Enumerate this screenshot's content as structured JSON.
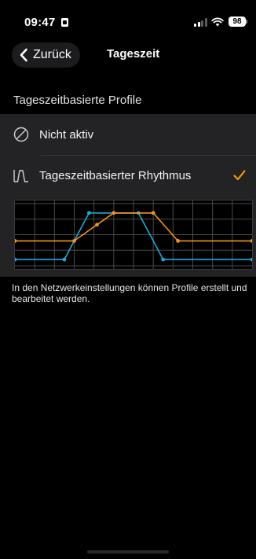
{
  "status_bar": {
    "time": "09:47",
    "battery": "98"
  },
  "header": {
    "back_label": "Zurück",
    "title": "Tageszeit"
  },
  "section": {
    "title": "Tageszeitbasierte Profile",
    "options": [
      {
        "label": "Nicht aktiv",
        "icon": "disabled-circle-icon",
        "selected": false
      },
      {
        "label": "Tageszeitbasierter Rhythmus",
        "icon": "rhythm-curve-icon",
        "selected": true
      }
    ]
  },
  "colors": {
    "accent": "#ff9f0a",
    "series_blue": "#1fa9d6",
    "series_orange": "#f0951e",
    "group_bg": "#232325"
  },
  "chart_data": {
    "type": "line",
    "x": [
      0,
      2,
      4,
      6,
      8,
      10,
      12,
      14,
      16,
      18,
      20,
      22,
      24
    ],
    "ylim": [
      0,
      100
    ],
    "grid": true,
    "series": [
      {
        "color": "#1fa9d6",
        "x": [
          0,
          5,
          7.5,
          12.5,
          15,
          24
        ],
        "values": [
          10,
          10,
          85,
          85,
          10,
          10
        ]
      },
      {
        "color": "#f0951e",
        "x": [
          0,
          6,
          8.3,
          10,
          14,
          16.5,
          24
        ],
        "values": [
          40,
          40,
          66,
          85,
          85,
          40,
          40
        ]
      }
    ]
  },
  "footer": {
    "text": "In den Netzwerkeinstellungen können Profile erstellt und bearbeitet werden."
  }
}
